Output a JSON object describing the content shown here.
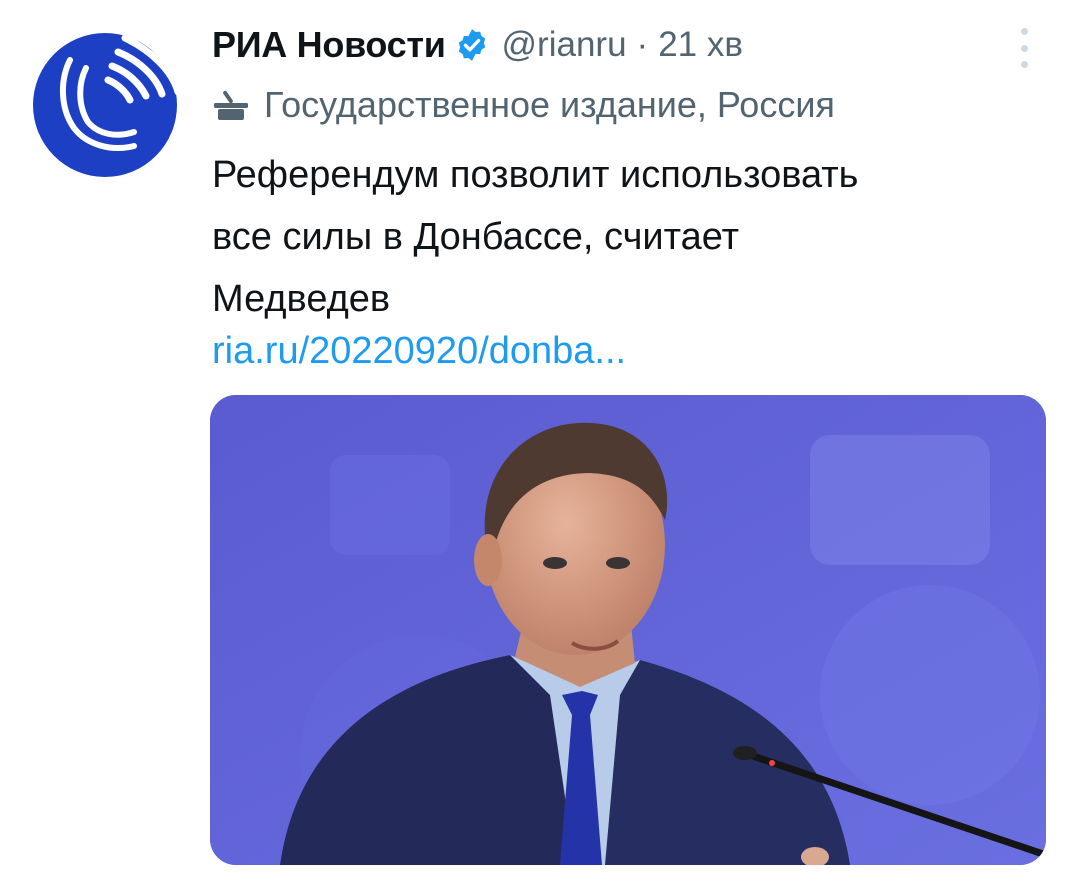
{
  "tweet": {
    "author_name": "РИА Новости",
    "handle": "@rianru",
    "separator": "·",
    "time": "21 хв",
    "label": "Государственное издание, Россия",
    "text_lines": [
      "Референдум позволит использовать",
      "все силы в Донбассе, считает",
      "Медведев"
    ],
    "link": "ria.ru/20220920/donba..."
  },
  "colors": {
    "brand_blue": "#1d3fc4",
    "link": "#1d9bf0",
    "verified": "#1d9bf0",
    "muted": "#536471",
    "text": "#0f1419",
    "photo_background": "#5b5fcf"
  },
  "icons": {
    "verified": "verified-badge-icon",
    "label": "government-lectern-icon",
    "more": "more-options-icon"
  }
}
